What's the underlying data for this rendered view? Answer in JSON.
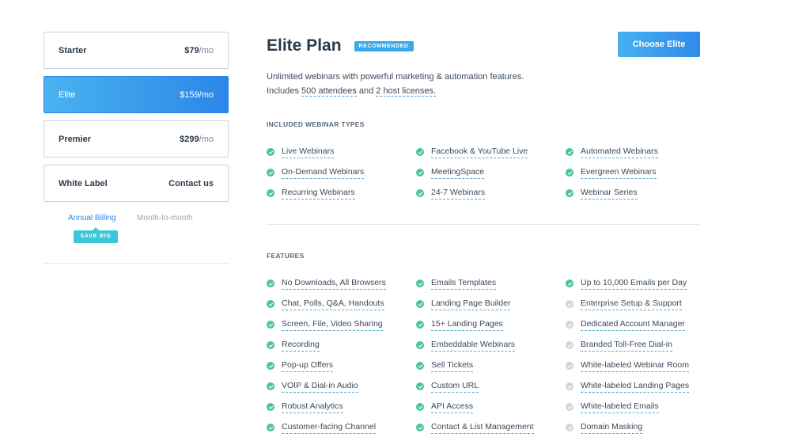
{
  "sidebar": {
    "plans": [
      {
        "name": "Starter",
        "price": "$79",
        "per": "/mo",
        "active": false
      },
      {
        "name": "Elite",
        "price": "$159",
        "per": "/mo",
        "active": true
      },
      {
        "name": "Premier",
        "price": "$299",
        "per": "/mo",
        "active": false
      },
      {
        "name": "White Label",
        "price": "Contact us",
        "per": "",
        "active": false
      }
    ],
    "billing": {
      "annual": "Annual Billing",
      "monthly": "Month-to-month",
      "save_badge": "SAVE BIG"
    }
  },
  "main": {
    "title": "Elite Plan",
    "recommended_badge": "RECOMMENDED",
    "choose_button": "Choose Elite",
    "desc_line1": "Unlimited webinars with powerful marketing & automation features.",
    "desc_includes": "Includes",
    "desc_attendees": "500 attendees",
    "desc_and": "and",
    "desc_licenses": "2 host licenses."
  },
  "webinar_types": {
    "heading": "INCLUDED WEBINAR TYPES",
    "items": [
      {
        "label": "Live Webinars",
        "included": true
      },
      {
        "label": "Facebook & YouTube Live",
        "included": true
      },
      {
        "label": "Automated Webinars",
        "included": true
      },
      {
        "label": "On-Demand Webinars",
        "included": true
      },
      {
        "label": "MeetingSpace",
        "included": true
      },
      {
        "label": "Evergreen Webinars",
        "included": true
      },
      {
        "label": "Recurring Webinars",
        "included": true
      },
      {
        "label": "24-7 Webinars",
        "included": true
      },
      {
        "label": "Webinar Series",
        "included": true
      }
    ]
  },
  "features": {
    "heading": "FEATURES",
    "items": [
      {
        "label": "No Downloads, All Browsers",
        "included": true
      },
      {
        "label": "Emails Templates",
        "included": true
      },
      {
        "label": "Up to 10,000 Emails per Day",
        "included": true
      },
      {
        "label": "Chat, Polls, Q&A, Handouts",
        "included": true
      },
      {
        "label": "Landing Page Builder",
        "included": true
      },
      {
        "label": "Enterprise Setup & Support",
        "included": false
      },
      {
        "label": "Screen, File, Video Sharing",
        "included": true
      },
      {
        "label": "15+ Landing Pages",
        "included": true
      },
      {
        "label": "Dedicated Account Manager",
        "included": false
      },
      {
        "label": "Recording",
        "included": true
      },
      {
        "label": "Embeddable Webinars",
        "included": true
      },
      {
        "label": "Branded Toll-Free Dial-in",
        "included": false
      },
      {
        "label": "Pop-up Offers",
        "included": true
      },
      {
        "label": "Sell Tickets",
        "included": true
      },
      {
        "label": "White-labeled Webinar Room",
        "included": false
      },
      {
        "label": "VOIP & Dial-in Audio",
        "included": true
      },
      {
        "label": "Custom URL",
        "included": true
      },
      {
        "label": "White-labeled Landing Pages",
        "included": false
      },
      {
        "label": "Robust Analytics",
        "included": true
      },
      {
        "label": "API Access",
        "included": true
      },
      {
        "label": "White-labeled Emails",
        "included": false
      },
      {
        "label": "Customer-facing Channel",
        "included": true
      },
      {
        "label": "Contact & List Management",
        "included": true
      },
      {
        "label": "Domain Masking",
        "included": false
      }
    ]
  },
  "colors": {
    "accent": "#2b87e8",
    "check_on": "#4cc49a",
    "check_off": "#cfd6dd",
    "save_badge": "#3cc6d8"
  }
}
